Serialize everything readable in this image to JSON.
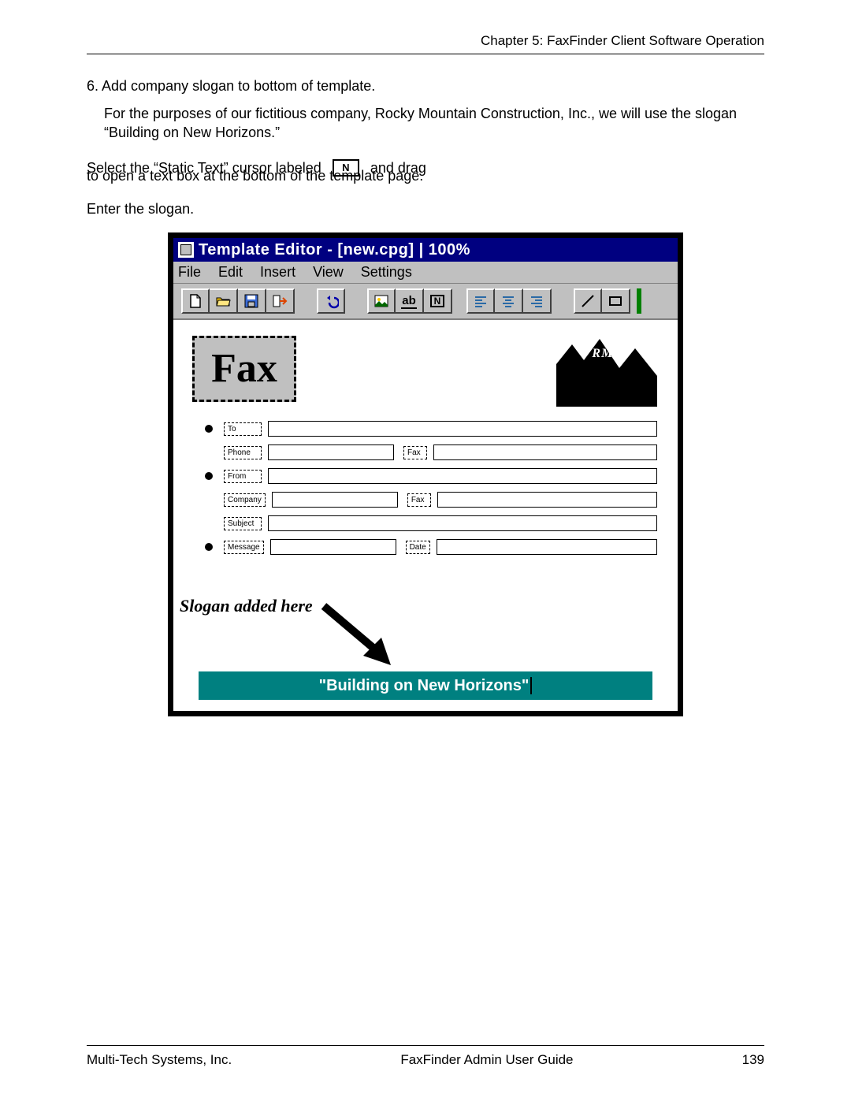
{
  "header": {
    "chapter": "Chapter 5: FaxFinder Client Software Operation"
  },
  "body": {
    "step_num": "6. Add company slogan to bottom of template.",
    "step_desc": "For the purposes of our fictitious company, Rocky Mountain Construction, Inc., we will use the slogan “Building on New Horizons.”",
    "select_pre": "Select the “Static Text” cursor labeled",
    "n_button": "N",
    "select_post": "and drag",
    "select_line2": "to open a text box at the bottom of the template page.",
    "enter_slogan": "Enter the slogan."
  },
  "window": {
    "title": "Template Editor - [new.cpg] | 100%",
    "menus": [
      "File",
      "Edit",
      "Insert",
      "View",
      "Settings"
    ],
    "toolbar": {
      "new": "new-icon",
      "open": "open-icon",
      "save": "save-icon",
      "exit": "exit-icon",
      "undo": "undo-icon",
      "image": "image-icon",
      "text_label_ab": "ab",
      "text_label_n": "N",
      "align_left": "align-left-icon",
      "align_center": "align-center-icon",
      "align_right": "align-right-icon",
      "line_tool": "line-icon",
      "rect_tool": "rect-icon"
    },
    "fax_label": "Fax",
    "logo_text": "RMC",
    "fields": {
      "to": "To",
      "phone": "Phone",
      "fax1": "Fax",
      "from": "From",
      "company": "Company",
      "fax2": "Fax",
      "subject": "Subject",
      "message": "Message",
      "date": "Date"
    },
    "annotation": "Slogan added here",
    "slogan": "\"Building on New Horizons\""
  },
  "footer": {
    "left": "Multi-Tech Systems, Inc.",
    "center": "FaxFinder Admin User Guide",
    "right": "139"
  }
}
